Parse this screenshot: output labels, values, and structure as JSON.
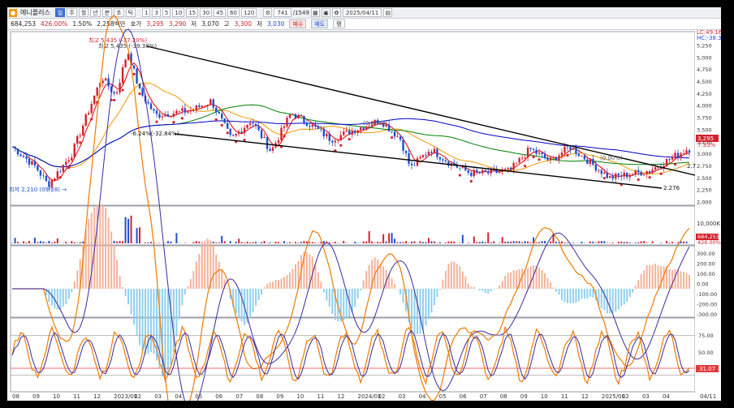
{
  "toolbar": {
    "stock_name": "에니플러스",
    "stock_badge": "신",
    "period_buttons": [
      "주",
      "월",
      "년",
      "분",
      "초",
      "틱",
      "1",
      "3",
      "5",
      "10",
      "15",
      "30",
      "45",
      "60",
      "120"
    ],
    "active_period": "일",
    "count_field": "741",
    "count_total": "/1549",
    "date_field": "2025/04/11"
  },
  "quote": {
    "volume": "684,253",
    "change_abs": "426.00%",
    "change_rate": "1.50%",
    "trade_value": "2,258백만",
    "ask_label": "호가",
    "ask": "3,295",
    "bid": "3,290",
    "low_label": "저",
    "low": "3,070",
    "high_label": "고",
    "high": "3,300",
    "close_label": "저",
    "close": "3,030",
    "buy_label": "매수",
    "sell_label": "매도",
    "flat_label": "평"
  },
  "price_panel": {
    "lc_label": "LC:49.16",
    "hc_label": "HC:-38.30",
    "current_price": "3,295",
    "current_pct": "7.33%",
    "high_annotation": "최고 5,435 (-37.20%)",
    "high_annotation2": "최고 5,435 (-39.38%)",
    "low_annotation": "최저 2,210 (09/28) →",
    "channel_annotation": "-6.24%(-32.84%)",
    "mid_annotation1": "(0.00%)",
    "mid_annotation2": "(0.00%)",
    "line_label_upper": "2.7",
    "line_label_lower": "2.276",
    "y_ticks": [
      "5,250",
      "5,000",
      "4,750",
      "4,500",
      "4,250",
      "4,000",
      "3,750",
      "3,500",
      "3,250",
      "3,000",
      "2,750",
      "2,500",
      "2,250",
      "2,000"
    ]
  },
  "volume_panel": {
    "y_tick": "10,000K",
    "current_volume": "684,253",
    "current_pct": "426.00%"
  },
  "macd_panel": {
    "y_ticks": [
      "300.00",
      "200.00",
      "100.00",
      "0.00",
      "-100.00",
      "-200.00",
      "-300.00"
    ]
  },
  "stoch_panel": {
    "y_ticks": [
      "75.00",
      "50.00",
      "25.00"
    ],
    "current_value": "31.07"
  },
  "x_axis": {
    "labels": [
      "08",
      "09",
      "10",
      "11",
      "12",
      "2023/01",
      "02",
      "03",
      "04",
      "05",
      "06",
      "07",
      "08",
      "09",
      "10",
      "11",
      "12",
      "2024/01",
      "02",
      "03",
      "04",
      "05",
      "06",
      "07",
      "08",
      "09",
      "10",
      "11",
      "12",
      "2025/01",
      "02",
      "03",
      "04"
    ],
    "end_label": "04/11"
  },
  "colors": {
    "up": "#d2222d",
    "down": "#1e4fd0",
    "ma5": "#e60000",
    "ma20": "#f39800",
    "ma60": "#008000",
    "ma120": "#0000cd",
    "channel": "#000000"
  }
}
